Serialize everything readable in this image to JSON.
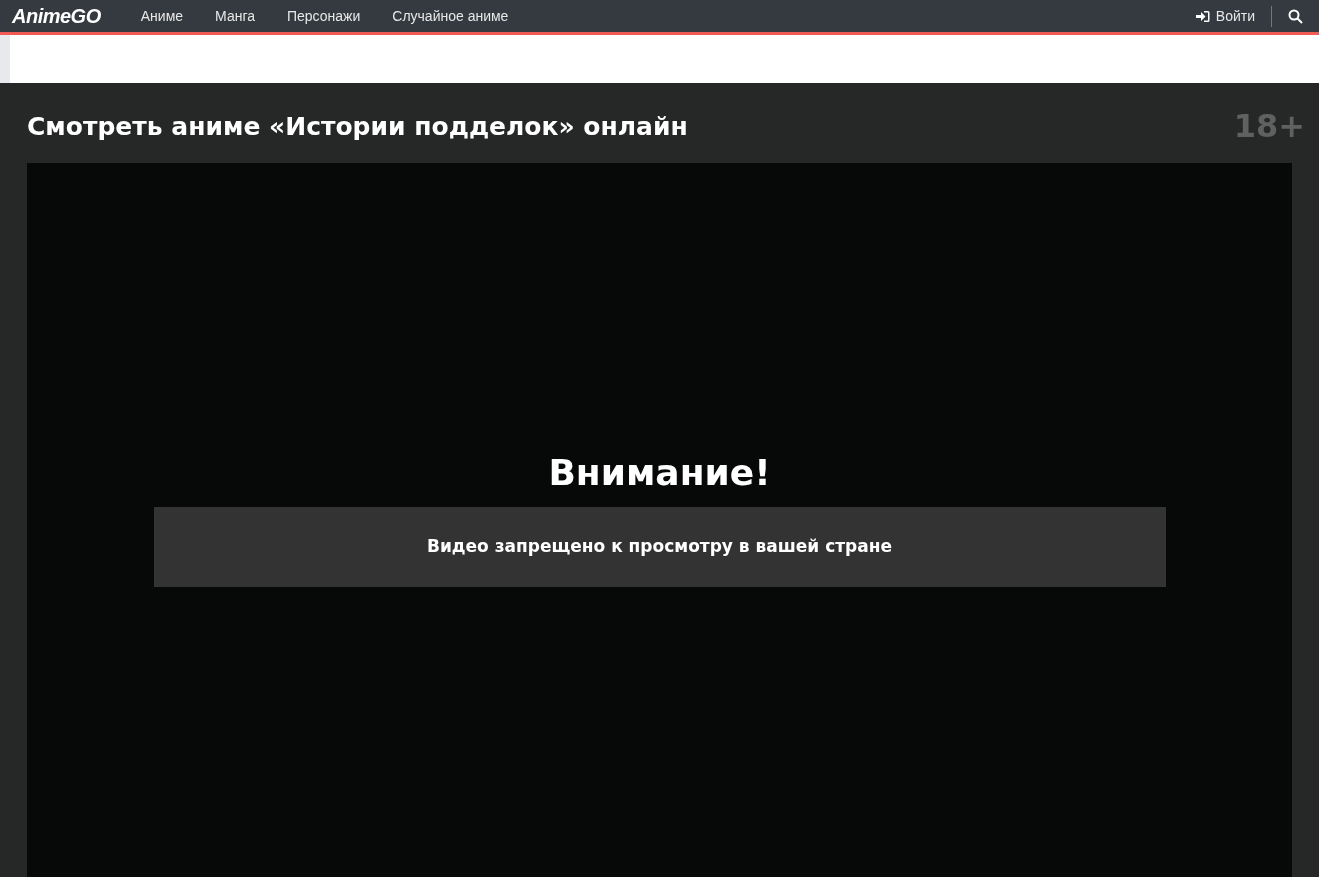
{
  "header": {
    "logo": "AnimeGO",
    "nav": [
      "Аниме",
      "Манга",
      "Персонажи",
      "Случайное аниме"
    ],
    "login": "Войти"
  },
  "page": {
    "title": "Смотреть аниме «Истории подделок» онлайн",
    "age_rating": "18+"
  },
  "player": {
    "heading": "Внимание!",
    "message": "Видео запрещено к просмотру в вашей стране"
  }
}
